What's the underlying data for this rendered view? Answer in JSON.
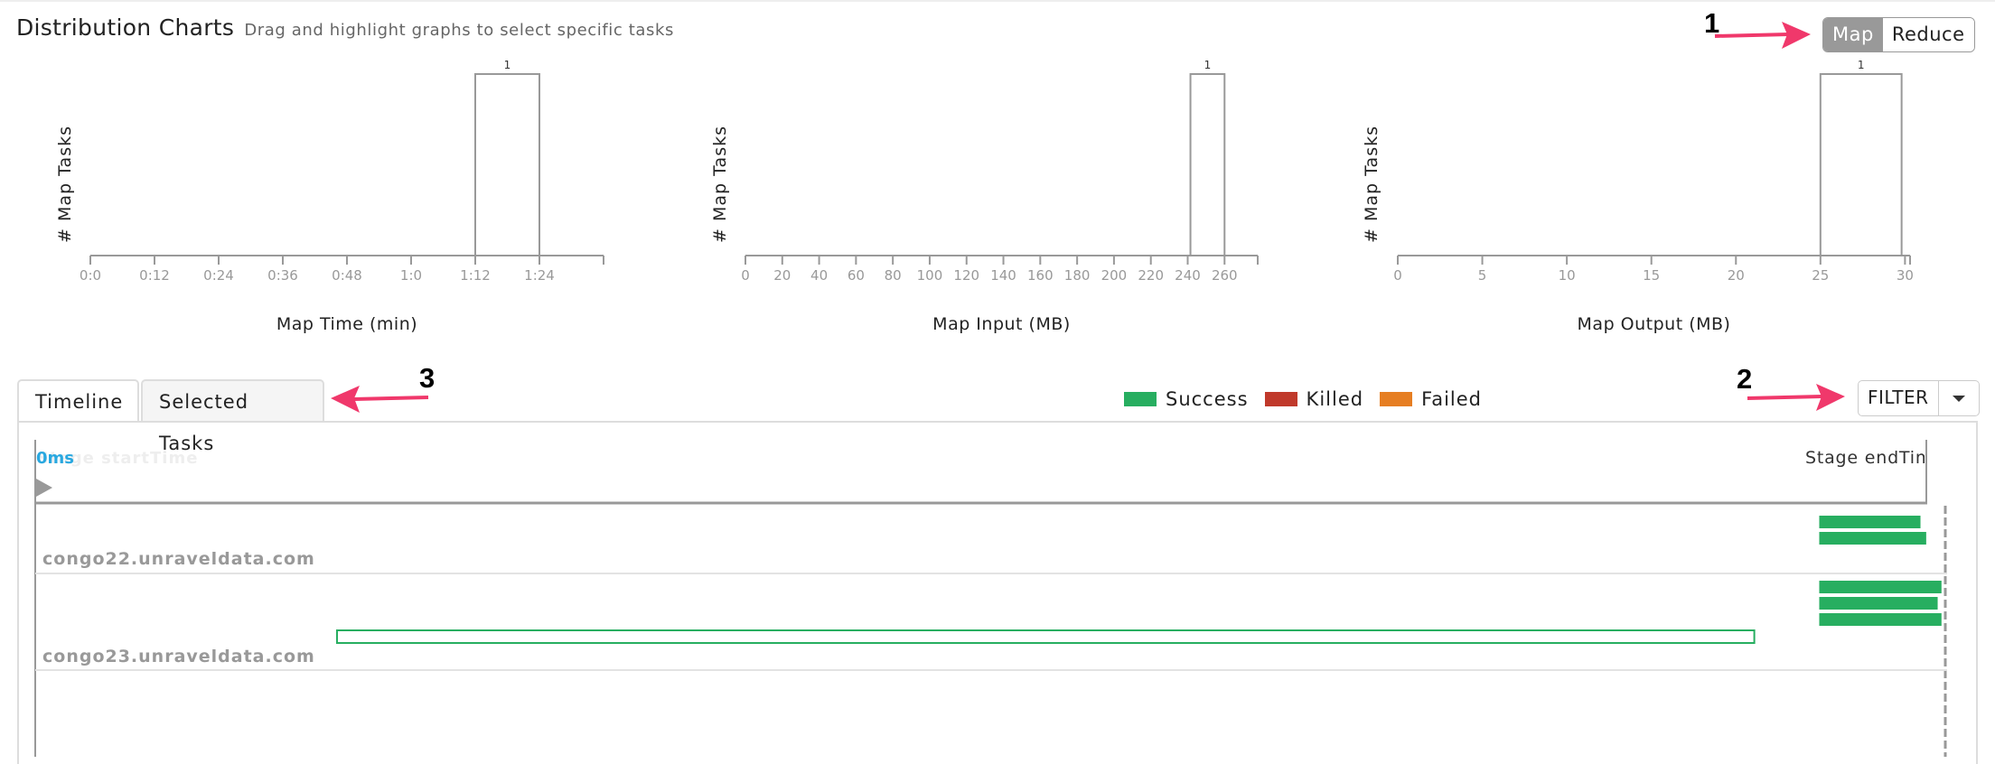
{
  "header": {
    "title": "Distribution Charts",
    "subtitle": "Drag and highlight graphs to select specific tasks"
  },
  "toggle": {
    "options": [
      "Map",
      "Reduce"
    ],
    "selected": "Map"
  },
  "annotations": [
    "1",
    "2",
    "3"
  ],
  "chart_data": [
    {
      "type": "bar",
      "title": "",
      "xlabel": "Map Time (min)",
      "ylabel": "# Map Tasks",
      "ticks": [
        "0:0",
        "0:12",
        "0:24",
        "0:36",
        "0:48",
        "1:0",
        "1:12",
        "1:24"
      ],
      "tick_values": [
        0,
        12,
        24,
        36,
        48,
        60,
        72,
        84
      ],
      "xlim": [
        0,
        96
      ],
      "bins": [
        {
          "start": 72,
          "end": 84,
          "count": 1,
          "label": "1"
        }
      ],
      "grid": false
    },
    {
      "type": "bar",
      "title": "",
      "xlabel": "Map Input (MB)",
      "ylabel": "# Map Tasks",
      "ticks": [
        "0",
        "20",
        "40",
        "60",
        "80",
        "100",
        "120",
        "140",
        "160",
        "180",
        "200",
        "220",
        "240",
        "260"
      ],
      "tick_values": [
        0,
        20,
        40,
        60,
        80,
        100,
        120,
        140,
        160,
        180,
        200,
        220,
        240,
        260
      ],
      "xlim": [
        0,
        278
      ],
      "bins": [
        {
          "start": 241.5,
          "end": 260,
          "count": 1,
          "label": "1"
        }
      ],
      "grid": false
    },
    {
      "type": "bar",
      "title": "",
      "xlabel": "Map Output (MB)",
      "ylabel": "# Map Tasks",
      "ticks": [
        "0",
        "5",
        "10",
        "15",
        "20",
        "25",
        "30"
      ],
      "tick_values": [
        0,
        5,
        10,
        15,
        20,
        25,
        30
      ],
      "xlim": [
        0,
        30.3
      ],
      "bins": [
        {
          "start": 25,
          "end": 29.8,
          "count": 1,
          "label": "1"
        }
      ],
      "grid": false
    }
  ],
  "tabs": [
    {
      "label": "Timeline",
      "active": true
    },
    {
      "label": "Selected Tasks",
      "active": false
    }
  ],
  "legend": [
    {
      "label": "Success",
      "color": "#27ae60"
    },
    {
      "label": "Killed",
      "color": "#c0392b"
    },
    {
      "label": "Failed",
      "color": "#e67e22"
    }
  ],
  "filter": {
    "label": "FILTER"
  },
  "timeline": {
    "start_value": "0ms",
    "start_label": "Stage startTime",
    "end_label": "Stage endTime",
    "hosts": [
      {
        "name": "congo22.unraveldata.com",
        "tasks": [
          {
            "status": "success",
            "start": 0.934,
            "end": 0.987,
            "filled": true
          },
          {
            "status": "success",
            "start": 0.934,
            "end": 0.99,
            "filled": true
          }
        ]
      },
      {
        "name": "congo23.unraveldata.com",
        "tasks": [
          {
            "status": "success",
            "start": 0.934,
            "end": 0.998,
            "filled": true
          },
          {
            "status": "success",
            "start": 0.934,
            "end": 0.996,
            "filled": true
          },
          {
            "status": "success",
            "start": 0.934,
            "end": 0.998,
            "filled": true
          },
          {
            "status": "success",
            "start": 0.158,
            "end": 0.9,
            "filled": false
          }
        ]
      }
    ]
  }
}
